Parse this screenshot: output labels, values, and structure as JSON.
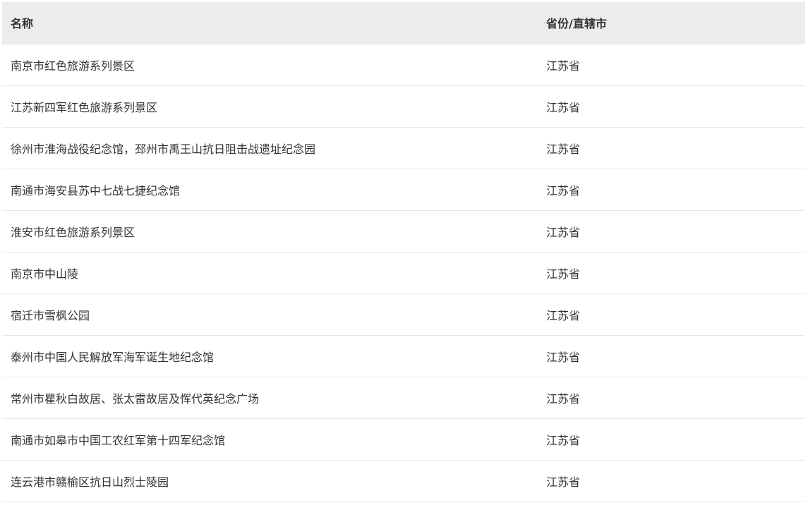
{
  "table": {
    "headers": {
      "name": "名称",
      "province": "省份/直辖市"
    },
    "rows": [
      {
        "name": "南京市红色旅游系列景区",
        "province": "江苏省"
      },
      {
        "name": "江苏新四军红色旅游系列景区",
        "province": "江苏省"
      },
      {
        "name": "徐州市淮海战役纪念馆，邳州市禹王山抗日阻击战遗址纪念园",
        "province": "江苏省"
      },
      {
        "name": "南通市海安县苏中七战七捷纪念馆",
        "province": "江苏省"
      },
      {
        "name": "淮安市红色旅游系列景区",
        "province": "江苏省"
      },
      {
        "name": "南京市中山陵",
        "province": "江苏省"
      },
      {
        "name": "宿迁市雪枫公园",
        "province": "江苏省"
      },
      {
        "name": "泰州市中国人民解放军海军诞生地纪念馆",
        "province": "江苏省"
      },
      {
        "name": "常州市瞿秋白故居、张太雷故居及恽代英纪念广场",
        "province": "江苏省"
      },
      {
        "name": "南通市如皋市中国工农红军第十四军纪念馆",
        "province": "江苏省"
      },
      {
        "name": "连云港市赣榆区抗日山烈士陵园",
        "province": "江苏省"
      }
    ]
  },
  "colors": {
    "header_bg": "#ececec",
    "row_border": "#e8e8e8",
    "text": "#333333"
  }
}
